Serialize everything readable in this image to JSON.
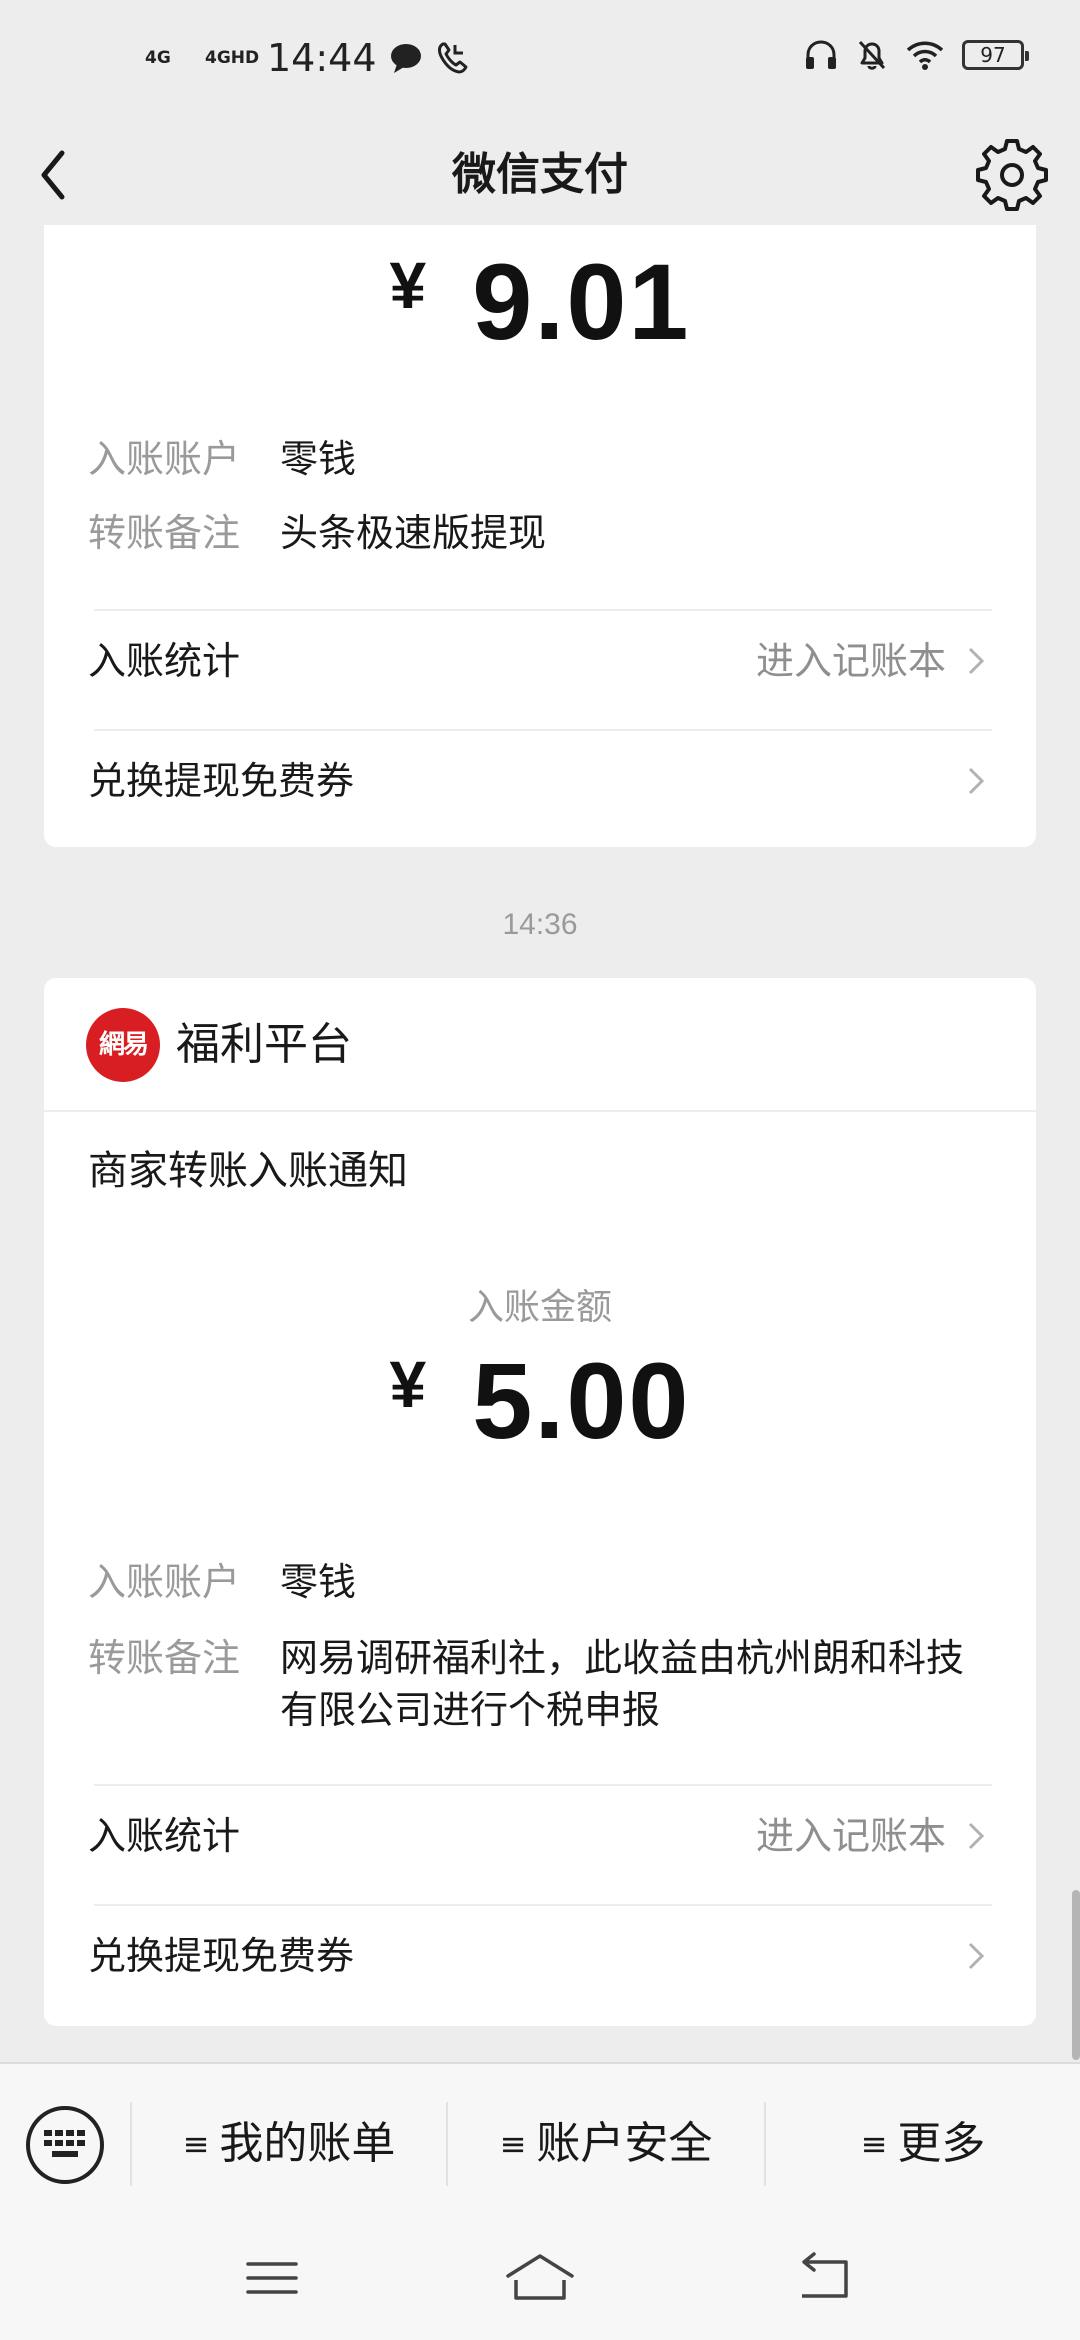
{
  "status_bar": {
    "signal1": "4G",
    "signal2": "4GHD",
    "time": "14:44",
    "battery": "97"
  },
  "nav": {
    "title": "微信支付"
  },
  "card1": {
    "currency": "¥",
    "amount": "9.01",
    "account_key": "入账账户",
    "account_value": "零钱",
    "remark_key": "转账备注",
    "remark_value": "头条极速版提现",
    "stats_label": "入账统计",
    "stats_link": "进入记账本",
    "coupon_label": "兑换提现免费券"
  },
  "timestamp": "14:36",
  "card2": {
    "merchant_logo": "網易",
    "merchant_name": "福利平台",
    "notice_title": "商家转账入账通知",
    "amount_label": "入账金额",
    "currency": "¥",
    "amount": "5.00",
    "account_key": "入账账户",
    "account_value": "零钱",
    "remark_key": "转账备注",
    "remark_value": "网易调研福利社，此收益由杭州朗和科技有限公司进行个税申报",
    "stats_label": "入账统计",
    "stats_link": "进入记账本",
    "coupon_label": "兑换提现免费券"
  },
  "menu": {
    "items": [
      {
        "label": "我的账单"
      },
      {
        "label": "账户安全"
      },
      {
        "label": "更多"
      }
    ],
    "menu_glyph": "≡"
  }
}
